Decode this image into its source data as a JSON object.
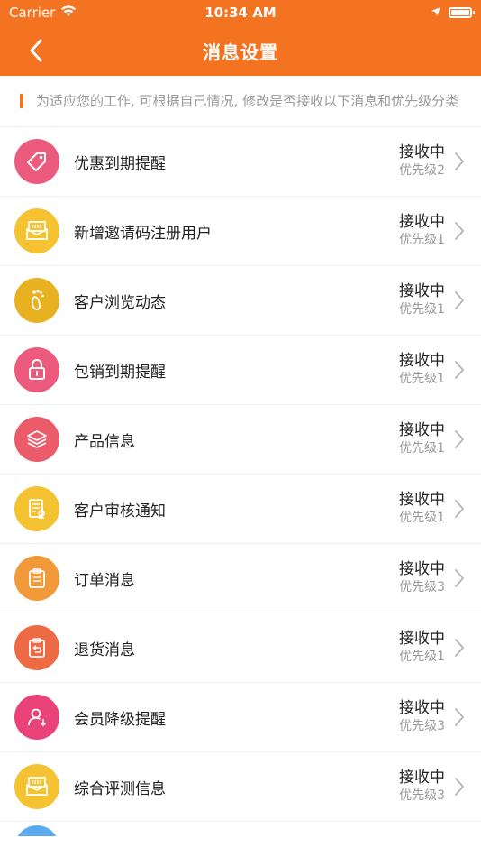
{
  "status_bar": {
    "carrier": "Carrier",
    "time": "10:34 AM"
  },
  "nav": {
    "title": "消息设置"
  },
  "notice": {
    "text": "为适应您的工作, 可根据自己情况, 修改是否接收以下消息和优先级分类"
  },
  "colors": {
    "header": "#f47321",
    "pink": "#ec5b7d",
    "yellow": "#f5c232",
    "gold": "#e8b122",
    "orange": "#f29a3a",
    "red_orange": "#ee6a44",
    "magenta": "#e9437a"
  },
  "items": [
    {
      "label": "优惠到期提醒",
      "status": "接收中",
      "priority": "优先级2",
      "icon": "tag-icon",
      "color": "#ec5b7d"
    },
    {
      "label": "新增邀请码注册用户",
      "status": "接收中",
      "priority": "优先级1",
      "icon": "envelope-icon",
      "color": "#f5c232"
    },
    {
      "label": "客户浏览动态",
      "status": "接收中",
      "priority": "优先级1",
      "icon": "footprint-icon",
      "color": "#e8b122"
    },
    {
      "label": "包销到期提醒",
      "status": "接收中",
      "priority": "优先级1",
      "icon": "lock-icon",
      "color": "#ec5b7d"
    },
    {
      "label": "产品信息",
      "status": "接收中",
      "priority": "优先级1",
      "icon": "layers-icon",
      "color": "#ec5b6a"
    },
    {
      "label": "客户审核通知",
      "status": "接收中",
      "priority": "优先级1",
      "icon": "document-icon",
      "color": "#f5c232"
    },
    {
      "label": "订单消息",
      "status": "接收中",
      "priority": "优先级3",
      "icon": "clipboard-icon",
      "color": "#f29a3a"
    },
    {
      "label": "退货消息",
      "status": "接收中",
      "priority": "优先级1",
      "icon": "return-icon",
      "color": "#ee6a44"
    },
    {
      "label": "会员降级提醒",
      "status": "接收中",
      "priority": "优先级3",
      "icon": "user-down-icon",
      "color": "#e9437a"
    },
    {
      "label": "综合评测信息",
      "status": "接收中",
      "priority": "优先级3",
      "icon": "envelope-icon",
      "color": "#f5c232"
    }
  ]
}
